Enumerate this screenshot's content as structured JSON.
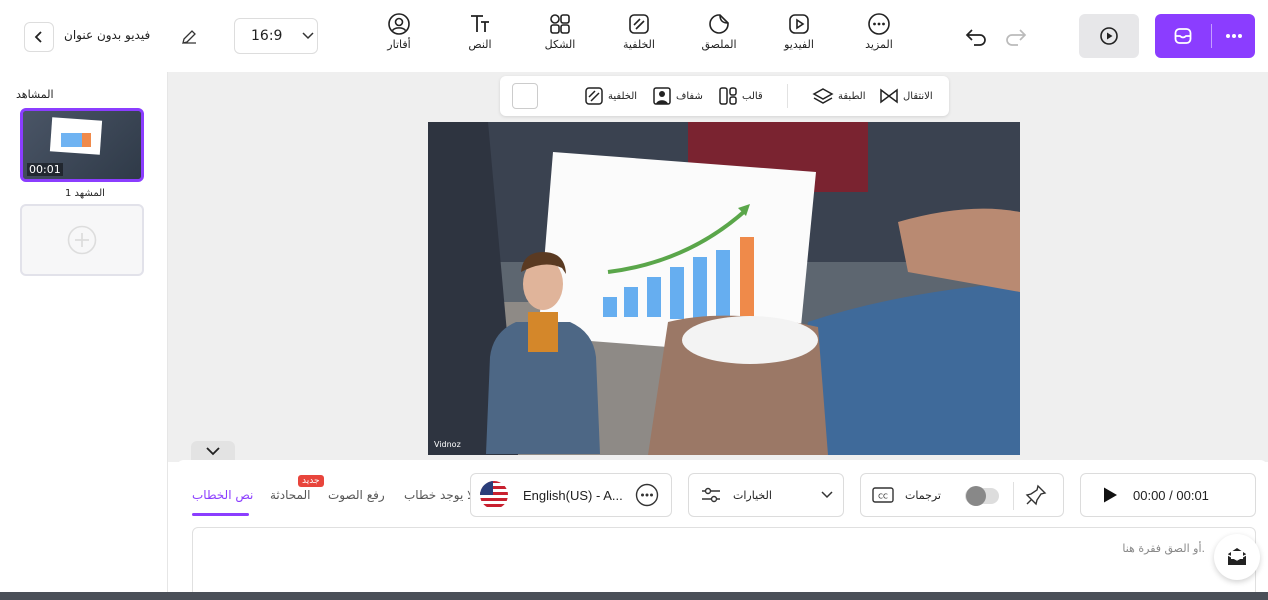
{
  "header": {
    "project_title": "فيديو بدون عنوان",
    "aspect_ratio": "16:9",
    "tools": [
      {
        "label": "أفاتار",
        "icon": "avatar-icon"
      },
      {
        "label": "النص",
        "icon": "text-icon"
      },
      {
        "label": "الشكل",
        "icon": "shape-icon"
      },
      {
        "label": "الخلفية",
        "icon": "background-icon"
      },
      {
        "label": "الملصق",
        "icon": "sticker-icon"
      },
      {
        "label": "الفيديو",
        "icon": "video-icon"
      },
      {
        "label": "المزيد",
        "icon": "more-icon"
      }
    ]
  },
  "sidebar": {
    "title": "المشاهد",
    "scenes": [
      {
        "label": "المشهد 1",
        "duration": "00:01"
      }
    ]
  },
  "context_toolbar": {
    "transition": "الانتقال",
    "layer": "الطبقة",
    "template": "قالب",
    "transparent": "شفاف",
    "background": "الخلفية"
  },
  "canvas": {
    "watermark": "Vidnoz"
  },
  "bottom": {
    "tabs": [
      "نص الخطاب",
      "المحادثة",
      "رفع الصوت",
      "لا يوجد خطاب"
    ],
    "new_badge": "جديد",
    "language": "English(US) - A...",
    "options_label": "الخيارات",
    "subtitles_label": "ترجمات",
    "time_display": "00:00 / 00:01",
    "script_placeholder": "أو الصق فقرة هنا."
  },
  "colors": {
    "accent": "#8b3dff",
    "badge": "#e8453c"
  }
}
